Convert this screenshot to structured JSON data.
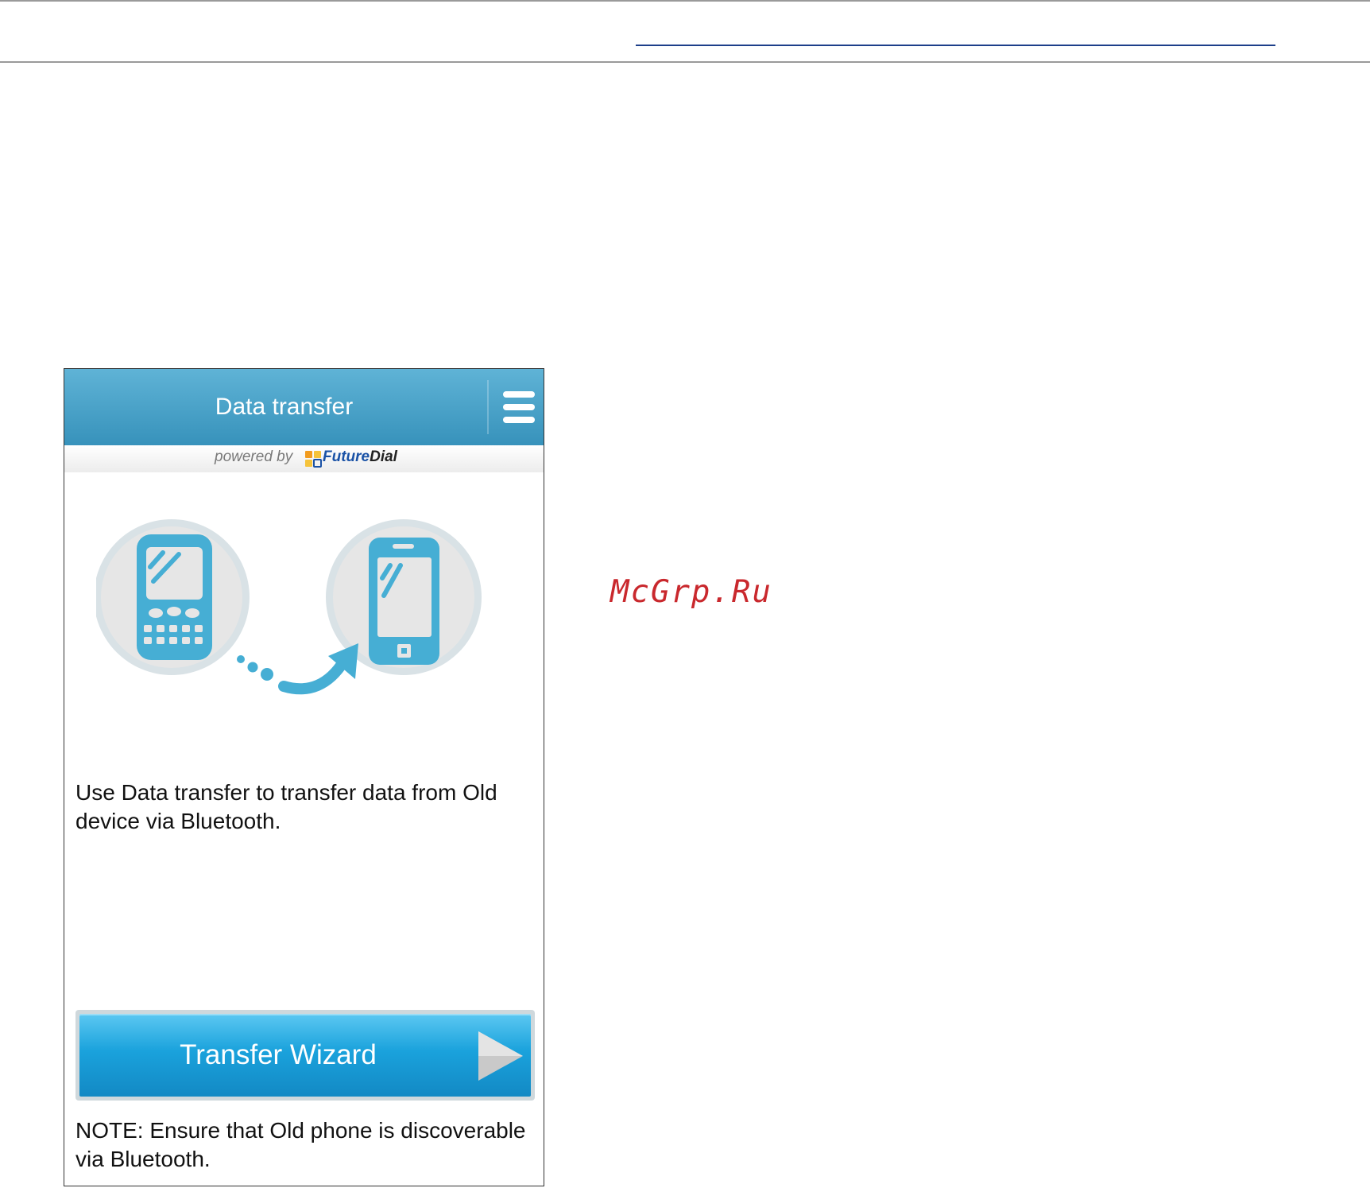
{
  "watermark": "McGrp.Ru",
  "app": {
    "title": "Data transfer",
    "menu_icon": "hamburger-menu-icon",
    "powered_by_label": "powered by",
    "brand_future": "Future",
    "brand_dial": "Dial"
  },
  "illustration": {
    "old_phone_icon": "old-phone-icon",
    "new_phone_icon": "smartphone-icon",
    "arrow_icon": "transfer-arrow-icon"
  },
  "description": "Use Data transfer to transfer data from Old device via Bluetooth.",
  "wizard_button": {
    "label": "Transfer Wizard",
    "icon": "play-arrow-icon"
  },
  "note": "NOTE: Ensure that Old phone is discoverable via Bluetooth.",
  "colors": {
    "app_bar": "#3a96bf",
    "accent": "#46aed4",
    "button": "#1aa2dc",
    "watermark": "#c9282d"
  }
}
